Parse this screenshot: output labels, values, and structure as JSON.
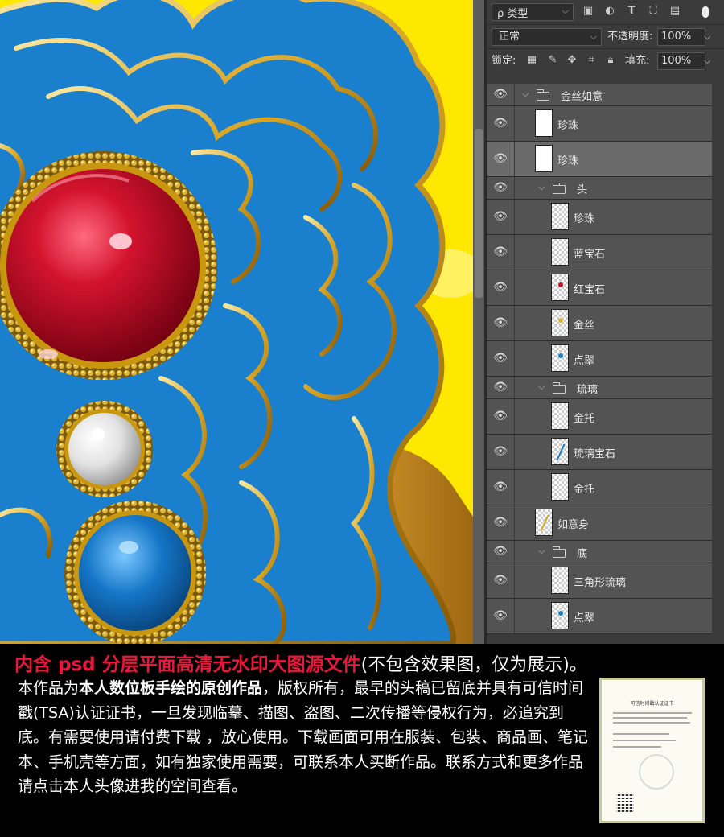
{
  "panel": {
    "filter_label": "ρ 类型",
    "blend_mode": "正常",
    "opacity_label": "不透明度:",
    "opacity_value": "100%",
    "lock_label": "锁定:",
    "fill_label": "填充:",
    "fill_value": "100%",
    "layers": [
      {
        "name": "金丝如意",
        "kind": "group",
        "level": 0
      },
      {
        "name": "珍珠",
        "kind": "layer",
        "level": 0,
        "thumb": "white"
      },
      {
        "name": "珍珠",
        "kind": "layer",
        "level": 0,
        "thumb": "white",
        "selected": true
      },
      {
        "name": "头",
        "kind": "group",
        "level": 1
      },
      {
        "name": "珍珠",
        "kind": "layer",
        "level": 1,
        "thumb": "checker"
      },
      {
        "name": "蓝宝石",
        "kind": "layer",
        "level": 1,
        "thumb": "checker"
      },
      {
        "name": "红宝石",
        "kind": "layer",
        "level": 1,
        "thumb": "red-dot"
      },
      {
        "name": "金丝",
        "kind": "layer",
        "level": 1,
        "thumb": "gold-dot"
      },
      {
        "name": "点翠",
        "kind": "layer",
        "level": 1,
        "thumb": "blue-dot"
      },
      {
        "name": "琉璃",
        "kind": "group",
        "level": 1
      },
      {
        "name": "金托",
        "kind": "layer",
        "level": 1,
        "thumb": "checker"
      },
      {
        "name": "琉璃宝石",
        "kind": "layer",
        "level": 1,
        "thumb": "blue-line"
      },
      {
        "name": "金托",
        "kind": "layer",
        "level": 1,
        "thumb": "checker"
      },
      {
        "name": "如意身",
        "kind": "layer",
        "level": 0,
        "thumb": "gold-line"
      },
      {
        "name": "底",
        "kind": "group",
        "level": 1
      },
      {
        "name": "三角形琉璃",
        "kind": "layer",
        "level": 1,
        "thumb": "checker"
      },
      {
        "name": "点翠",
        "kind": "layer",
        "level": 1,
        "thumb": "blue-dot"
      }
    ]
  },
  "caption": {
    "headline": "内含 psd 分层平面高清无水印大图源文件",
    "headline_note": "(不包含效果图，仅为展示)。",
    "body_1": "本作品为",
    "body_bold": "本人数位板手绘的原创作品",
    "body_2": "，版权所有，最早的头稿已留底并具有可信时间戳(TSA)认证证书，一旦发现临摹、描图、盗图、二次传播等侵权行为，必追究到底。有需要使用请付费下载 ，放心使用。下载画面可用在服装、包装、商品画、笔记本、手机壳等方面，如有独家使用需要，可联系本人买断作品。联系方式和更多作品请点击本人头像进我的空间查看。",
    "certificate_title": "可信时间戳认证证书"
  },
  "colors": {
    "background_yellow": "#ffe800",
    "ruyi_blue": "#1a7fcc",
    "gold": "#d7a52a",
    "ruby": "#c0102a",
    "headline_red": "#e8183a"
  }
}
